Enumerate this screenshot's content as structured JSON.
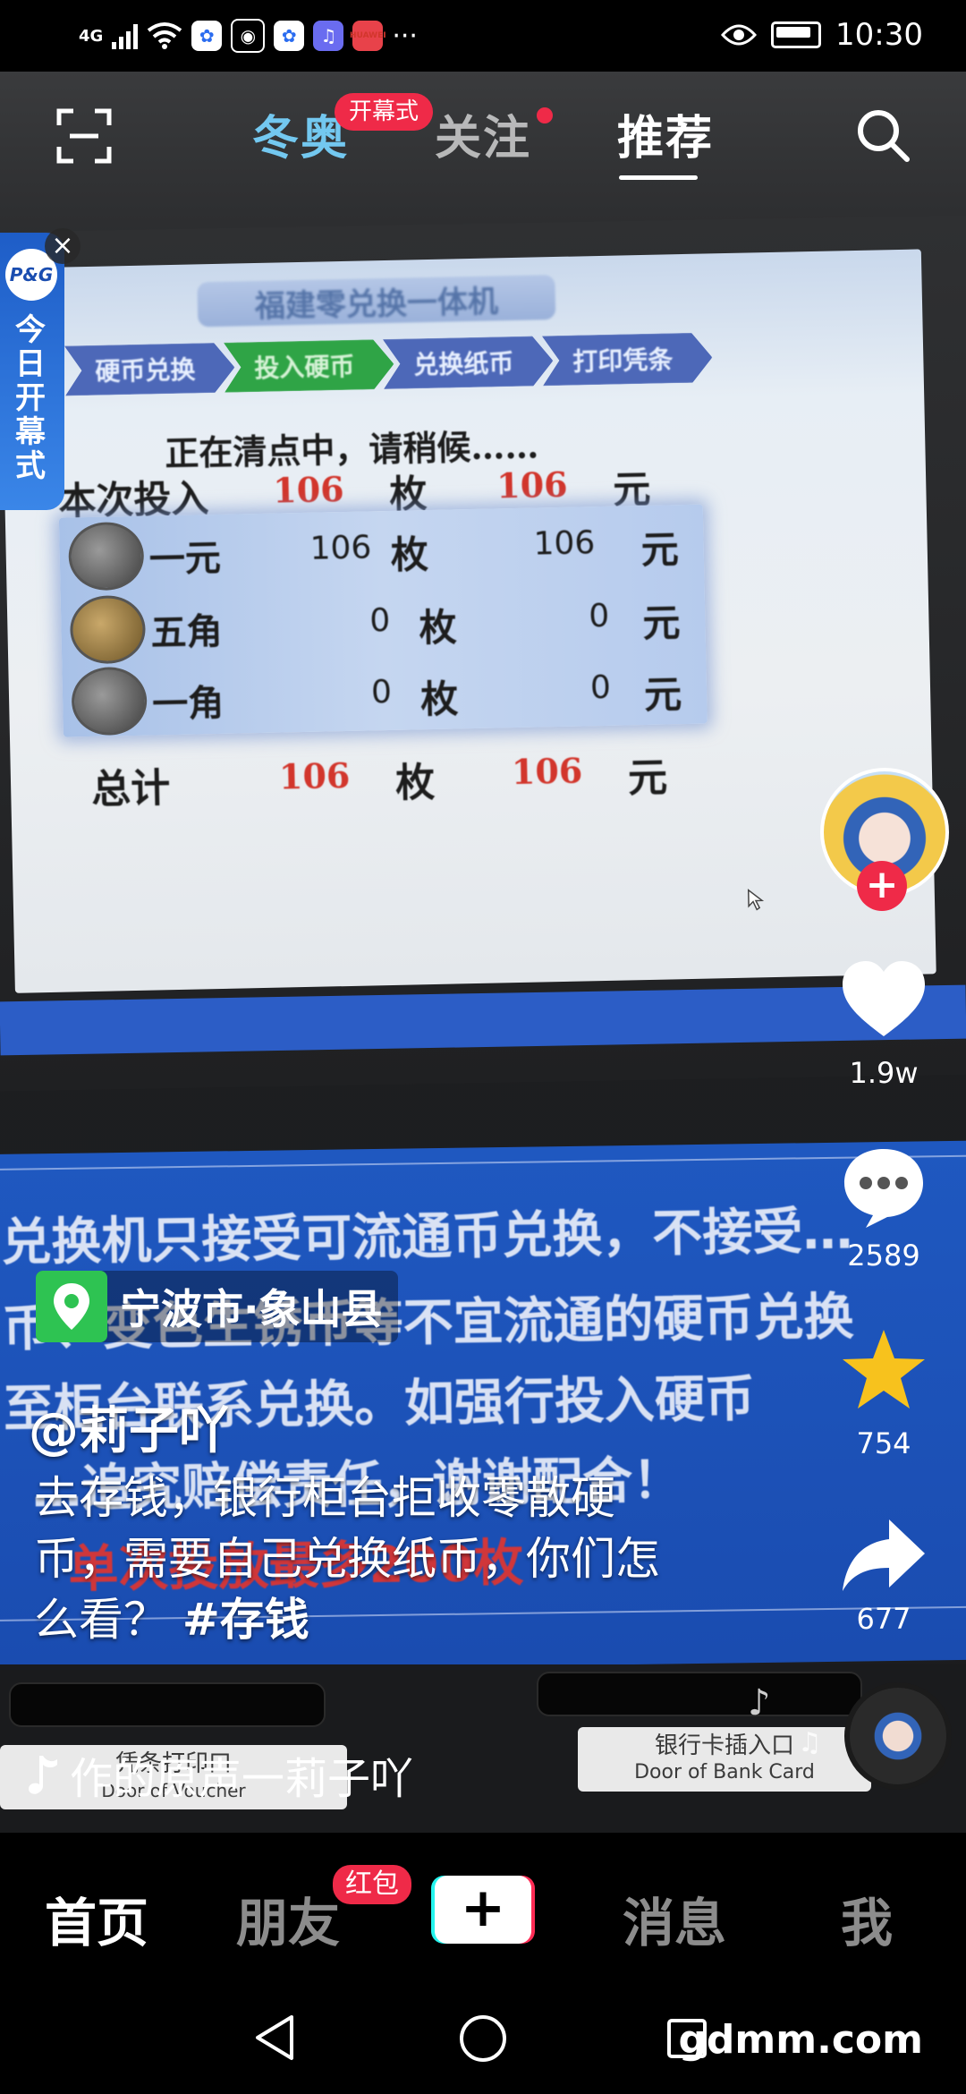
{
  "status_bar": {
    "network": "4G",
    "app_icons": [
      "baidu-icon",
      "weibo-icon",
      "baidu-icon",
      "music-icon",
      "huawei-icon"
    ],
    "huawei_label": "HUAWEI",
    "more": "···",
    "time": "10:30"
  },
  "top_nav": {
    "tabs": [
      {
        "label": "冬奥",
        "badge": "开幕式"
      },
      {
        "label": "关注"
      },
      {
        "label": "推荐",
        "active": true
      }
    ]
  },
  "ad": {
    "logo": "P&G",
    "text": "今日开幕式"
  },
  "video_screen": {
    "title": "福建零兑换一体机",
    "steps": [
      "硬币兑换",
      "投入硬币",
      "兑换纸币",
      "打印凭条"
    ],
    "status_text": "正在清点中，请稍候……",
    "summary_label": "本次投入",
    "rows": [
      {
        "name": "一元",
        "count": "106",
        "unit": "枚",
        "amount": "106",
        "currency": "元"
      },
      {
        "name": "五角",
        "count": "0",
        "unit": "枚",
        "amount": "0",
        "currency": "元"
      },
      {
        "name": "一角",
        "count": "0",
        "unit": "枚",
        "amount": "0",
        "currency": "元"
      }
    ],
    "this_time": {
      "count": "106",
      "unit": "枚",
      "amount": "106",
      "currency": "元"
    },
    "total_label": "总计",
    "total": {
      "count": "106",
      "unit": "枚",
      "amount": "106",
      "currency": "元"
    },
    "notice_lines": [
      "兑换机只接受可流通币兑换，不接受…",
      "币、变色生锈币等不宜流通的硬币兑换",
      "至柜台联系兑换。如强行投入硬币",
      "…追究赔偿责任，谢谢配合！",
      "单次投放最多200枚"
    ],
    "bank_card_slot": "银行卡插入口",
    "bank_card_slot_en": "Door of Bank Card",
    "voucher_slot": "凭条打印口",
    "voucher_slot_en": "Door of Voucher"
  },
  "actions": {
    "likes": "1.9w",
    "comments": "2589",
    "favorites": "754",
    "shares": "677"
  },
  "post": {
    "location": "宁波市·象山县",
    "username": "@莉子吖",
    "description": "去存钱，银行柜台拒收零散硬币，需要自己兑换纸币，你们怎么看？",
    "hashtag": "#存钱",
    "music": "作的原声一莉子吖"
  },
  "bottom_tabs": {
    "home": "首页",
    "friends": "朋友",
    "friends_badge": "红包",
    "create": "+",
    "messages": "消息",
    "me": "我"
  },
  "watermark": "gdmm.com",
  "colors": {
    "accent_red": "#ef2a48",
    "location_green": "#2ec352",
    "favorite_yellow": "#f7c21d",
    "olympic_blue": "#73c8f0"
  }
}
